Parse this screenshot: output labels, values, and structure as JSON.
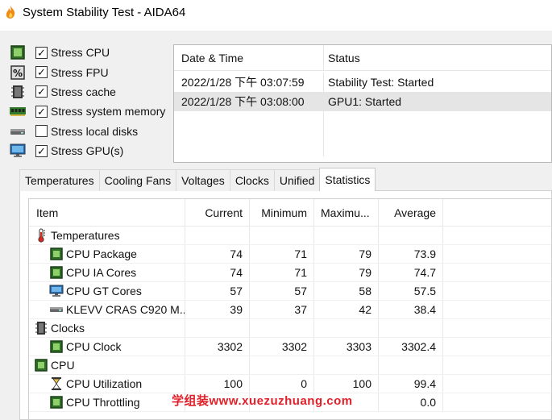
{
  "window": {
    "title": "System Stability Test - AIDA64",
    "icon": "flame-icon"
  },
  "stress_options": [
    {
      "label": "Stress CPU",
      "checked": true,
      "icon": "cpu-chip-icon"
    },
    {
      "label": "Stress FPU",
      "checked": true,
      "icon": "fpu-percent-icon"
    },
    {
      "label": "Stress cache",
      "checked": true,
      "icon": "cache-chip-icon"
    },
    {
      "label": "Stress system memory",
      "checked": true,
      "icon": "memory-module-icon"
    },
    {
      "label": "Stress local disks",
      "checked": false,
      "icon": "disk-drive-icon"
    },
    {
      "label": "Stress GPU(s)",
      "checked": true,
      "icon": "monitor-icon"
    }
  ],
  "log": {
    "headers": {
      "datetime": "Date & Time",
      "status": "Status"
    },
    "rows": [
      {
        "datetime": "2022/1/28 下午 03:07:59",
        "status": "Stability Test: Started",
        "selected": false
      },
      {
        "datetime": "2022/1/28 下午 03:08:00",
        "status": "GPU1: Started",
        "selected": true
      }
    ]
  },
  "tabs": [
    {
      "label": "Temperatures",
      "active": false
    },
    {
      "label": "Cooling Fans",
      "active": false
    },
    {
      "label": "Voltages",
      "active": false
    },
    {
      "label": "Clocks",
      "active": false
    },
    {
      "label": "Unified",
      "active": false
    },
    {
      "label": "Statistics",
      "active": true
    }
  ],
  "stats": {
    "headers": {
      "item": "Item",
      "current": "Current",
      "minimum": "Minimum",
      "maximum": "Maximu...",
      "average": "Average"
    },
    "rows": [
      {
        "type": "group",
        "item": "Temperatures",
        "icon": "thermometer-icon"
      },
      {
        "type": "item",
        "item": "CPU Package",
        "icon": "cpu-chip-icon",
        "current": "74",
        "minimum": "71",
        "maximum": "79",
        "average": "73.9"
      },
      {
        "type": "item",
        "item": "CPU IA Cores",
        "icon": "cpu-chip-icon",
        "current": "74",
        "minimum": "71",
        "maximum": "79",
        "average": "74.7"
      },
      {
        "type": "item",
        "item": "CPU GT Cores",
        "icon": "monitor-icon",
        "current": "57",
        "minimum": "57",
        "maximum": "58",
        "average": "57.5"
      },
      {
        "type": "item",
        "item": "KLEVV CRAS C920 M...",
        "icon": "ssd-drive-icon",
        "current": "39",
        "minimum": "37",
        "maximum": "42",
        "average": "38.4"
      },
      {
        "type": "group",
        "item": "Clocks",
        "icon": "clock-chip-icon"
      },
      {
        "type": "item",
        "item": "CPU Clock",
        "icon": "cpu-chip-icon",
        "current": "3302",
        "minimum": "3302",
        "maximum": "3303",
        "average": "3302.4"
      },
      {
        "type": "group",
        "item": "CPU",
        "icon": "cpu-chip-icon"
      },
      {
        "type": "item",
        "item": "CPU Utilization",
        "icon": "hourglass-icon",
        "current": "100",
        "minimum": "0",
        "maximum": "100",
        "average": "99.4"
      },
      {
        "type": "item",
        "item": "CPU Throttling",
        "icon": "cpu-chip-icon",
        "current": "",
        "minimum": "",
        "maximum": "",
        "average": "0.0"
      }
    ]
  },
  "watermark": "学组装www.xuezuzhuang.com",
  "colors": {
    "chip_green": "#3a7d2c",
    "selected_row": "#e5e5e5",
    "watermark": "#e0202a"
  }
}
